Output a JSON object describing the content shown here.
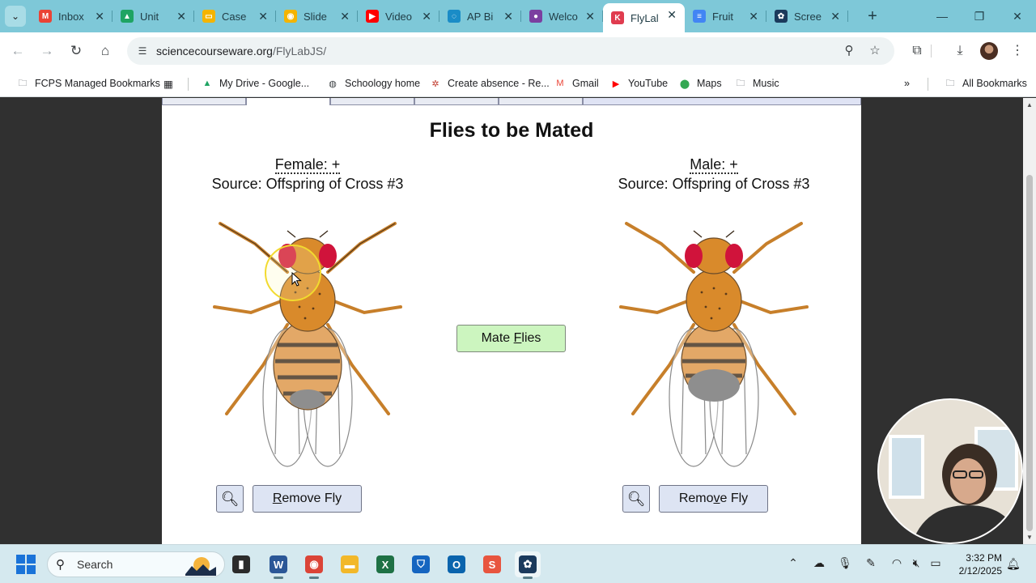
{
  "browser": {
    "tabs": [
      {
        "label": "Inbox",
        "icon": "gmail-icon",
        "color": "#EA4335",
        "glyph": "M"
      },
      {
        "label": "Unit",
        "icon": "drive-icon",
        "color": "#1FA463",
        "glyph": "▲"
      },
      {
        "label": "Case",
        "icon": "slides-icon",
        "color": "#F4B400",
        "glyph": "▭"
      },
      {
        "label": "Slide",
        "icon": "slides-bulb-icon",
        "color": "#F4B400",
        "glyph": "◉"
      },
      {
        "label": "Video",
        "icon": "youtube-icon",
        "color": "#FF0000",
        "glyph": "▶"
      },
      {
        "label": "AP Bi",
        "icon": "ap-icon",
        "color": "#1a8cc7",
        "glyph": "◌"
      },
      {
        "label": "Welco",
        "icon": "course-icon",
        "color": "#7b3fa0",
        "glyph": "●"
      },
      {
        "label": "FlyLal",
        "icon": "flylab-icon",
        "color": "#e03c4f",
        "glyph": "K"
      },
      {
        "label": "Fruit",
        "icon": "docs-icon",
        "color": "#4285F4",
        "glyph": "≡"
      },
      {
        "label": "Scree",
        "icon": "screencastify-icon",
        "color": "#1b3a5c",
        "glyph": "✿"
      }
    ],
    "active_tab_index": 7,
    "new_tab_glyph": "+",
    "window_controls": [
      "—",
      "❐",
      "✕"
    ],
    "url": {
      "host": "sciencecourseware.org",
      "path": "/FlyLabJS/"
    }
  },
  "bookmarks": [
    {
      "label": "FCPS Managed Bookmarks",
      "icon": "managed-folder-icon",
      "glyph": "🗀",
      "color": "#5f6368"
    },
    {
      "label": "My Drive - Google...",
      "icon": "drive-icon",
      "glyph": "▲",
      "color": "#1FA463"
    },
    {
      "label": "Schoology home",
      "icon": "globe-icon",
      "glyph": "◍",
      "color": "#3c4043"
    },
    {
      "label": "Create absence - Re...",
      "icon": "absence-icon",
      "glyph": "✲",
      "color": "#c0392b"
    },
    {
      "label": "Gmail",
      "icon": "gmail-icon",
      "glyph": "M",
      "color": "#EA4335"
    },
    {
      "label": "YouTube",
      "icon": "youtube-icon",
      "glyph": "▶",
      "color": "#FF0000"
    },
    {
      "label": "Maps",
      "icon": "maps-icon",
      "glyph": "⬤",
      "color": "#34A853"
    },
    {
      "label": "Music",
      "icon": "folder-icon",
      "glyph": "🗀",
      "color": "#5f6368"
    }
  ],
  "all_bookmarks": "All Bookmarks",
  "lab": {
    "title": "Flies to be Mated",
    "female": {
      "sex": "Female: +",
      "source": "Source: Offspring of Cross #3"
    },
    "male": {
      "sex": "Male: +",
      "source": "Source: Offspring of Cross #3"
    },
    "mate_button": {
      "before": "Mate ",
      "key": "F",
      "after": "lies"
    },
    "remove_female": {
      "before": "",
      "key": "R",
      "after": "emove Fly"
    },
    "remove_male": {
      "before": "Remo",
      "key": "v",
      "after": "e Fly"
    }
  },
  "taskbar": {
    "search_label": "Search",
    "apps": [
      {
        "name": "file-explorer-dark",
        "glyph": "▮",
        "color": "#2b2b2b"
      },
      {
        "name": "word",
        "glyph": "W",
        "color": "#2b5797"
      },
      {
        "name": "chrome",
        "glyph": "◉",
        "color": "#db4437"
      },
      {
        "name": "file-explorer",
        "glyph": "▬",
        "color": "#f2b829"
      },
      {
        "name": "excel",
        "glyph": "X",
        "color": "#1e7145"
      },
      {
        "name": "defender",
        "glyph": "⛉",
        "color": "#1565c0"
      },
      {
        "name": "outlook",
        "glyph": "O",
        "color": "#0a64ad"
      },
      {
        "name": "schoology-s",
        "glyph": "S",
        "color": "#e8553f"
      },
      {
        "name": "screencastify",
        "glyph": "✿",
        "color": "#1b3a5c"
      }
    ],
    "time": "3:32 PM",
    "date": "2/12/2025"
  }
}
